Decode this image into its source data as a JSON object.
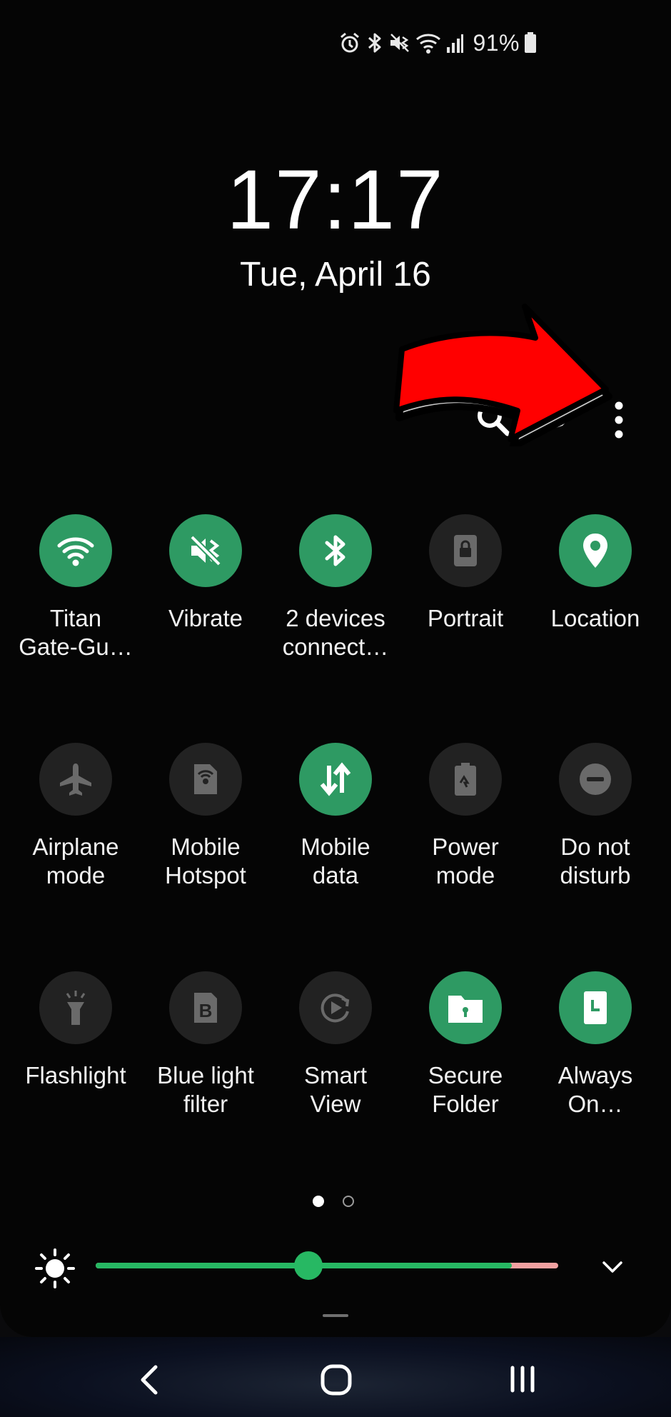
{
  "status_bar": {
    "icons": [
      "alarm-icon",
      "bluetooth-icon",
      "vibrate-icon",
      "wifi-icon",
      "signal-icon",
      "battery-icon"
    ],
    "battery_percent": "91%"
  },
  "lock": {
    "time": "17:17",
    "date": "Tue, April 16"
  },
  "header_actions": {
    "search_icon": "search-icon",
    "edit_icon": "pencil-icon",
    "more_icon": "more-vertical-icon"
  },
  "annotation": {
    "arrow_color": "#ff0000"
  },
  "quick_settings": {
    "tiles": [
      {
        "label": "Titan Gate-Gu…",
        "label_line1": "Titan",
        "label_line2": "Gate-Gu…",
        "icon": "wifi-icon",
        "active": true
      },
      {
        "label": "Vibrate",
        "label_line1": "Vibrate",
        "label_line2": "",
        "icon": "vibrate-icon",
        "active": true
      },
      {
        "label": "2 devices connect…",
        "label_line1": "2 devices",
        "label_line2": "connect…",
        "icon": "bluetooth-icon",
        "active": true
      },
      {
        "label": "Portrait",
        "label_line1": "Portrait",
        "label_line2": "",
        "icon": "rotation-lock-icon",
        "active": false
      },
      {
        "label": "Location",
        "label_line1": "Location",
        "label_line2": "",
        "icon": "location-pin-icon",
        "active": true
      },
      {
        "label": "Airplane mode",
        "label_line1": "Airplane",
        "label_line2": "mode",
        "icon": "airplane-icon",
        "active": false
      },
      {
        "label": "Mobile Hotspot",
        "label_line1": "Mobile",
        "label_line2": "Hotspot",
        "icon": "hotspot-icon",
        "active": false
      },
      {
        "label": "Mobile data",
        "label_line1": "Mobile",
        "label_line2": "data",
        "icon": "mobile-data-icon",
        "active": true
      },
      {
        "label": "Power mode",
        "label_line1": "Power",
        "label_line2": "mode",
        "icon": "power-mode-icon",
        "active": false
      },
      {
        "label": "Do not disturb",
        "label_line1": "Do not",
        "label_line2": "disturb",
        "icon": "do-not-disturb-icon",
        "active": false
      },
      {
        "label": "Flashlight",
        "label_line1": "Flashlight",
        "label_line2": "",
        "icon": "flashlight-icon",
        "active": false
      },
      {
        "label": "Blue light filter",
        "label_line1": "Blue light",
        "label_line2": "filter",
        "icon": "blue-light-filter-icon",
        "active": false
      },
      {
        "label": "Smart View",
        "label_line1": "Smart",
        "label_line2": "View",
        "icon": "smart-view-icon",
        "active": false
      },
      {
        "label": "Secure Folder",
        "label_line1": "Secure",
        "label_line2": "Folder",
        "icon": "secure-folder-icon",
        "active": true
      },
      {
        "label": "Always On…",
        "label_line1": "Always",
        "label_line2": "On…",
        "icon": "always-on-display-icon",
        "active": true
      }
    ],
    "page_indicator": {
      "current": 1,
      "total": 2
    }
  },
  "brightness": {
    "icon": "brightness-icon",
    "level_fraction": 0.46,
    "track_color": "#27b863",
    "high_zone_color": "#f2a1a1",
    "expand_icon": "chevron-down-icon"
  },
  "navigation_bar": {
    "back_icon": "back-icon",
    "home_icon": "home-icon",
    "recents_icon": "recents-icon"
  },
  "colors": {
    "active_tile": "#2e9a63",
    "inactive_tile": "#222222",
    "background": "#050505"
  }
}
